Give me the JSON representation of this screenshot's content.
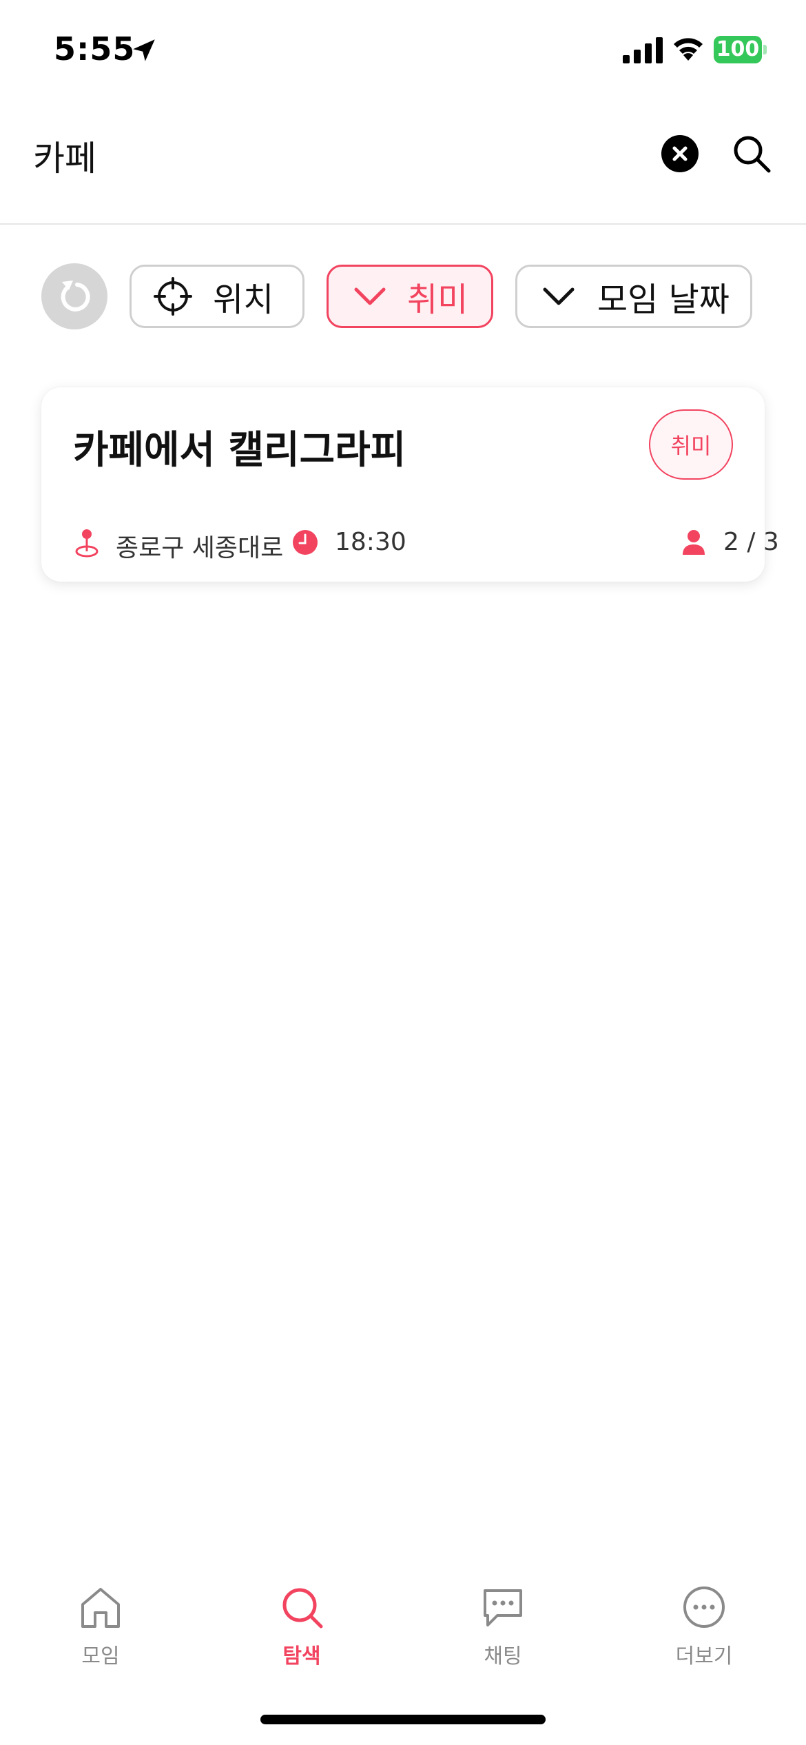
{
  "status_bar": {
    "time": "5:55",
    "battery_level": "100",
    "icons": [
      "location-arrow-icon",
      "cellular-signal-icon",
      "wifi-icon",
      "battery-icon"
    ]
  },
  "search": {
    "query": "카페",
    "clear_icon": "clear-icon",
    "search_icon": "search-icon"
  },
  "filters": {
    "reset_icon": "reset-icon",
    "chips": [
      {
        "label": "위치",
        "icon": "crosshair-icon",
        "active": false
      },
      {
        "label": "취미",
        "icon": "chevron-down-icon",
        "active": true
      },
      {
        "label": "모임 날짜",
        "icon": "chevron-down-icon",
        "active": false
      }
    ]
  },
  "results": [
    {
      "title": "카페에서 캘리그라피",
      "tag": "취미",
      "address": "종로구 세종대로",
      "time": "18:30",
      "participants": "2 / 3"
    }
  ],
  "tab_bar": {
    "tabs": [
      {
        "label": "모임",
        "icon": "home-icon",
        "active": false
      },
      {
        "label": "탐색",
        "icon": "search-icon",
        "active": true
      },
      {
        "label": "채팅",
        "icon": "chat-bubble-icon",
        "active": false
      },
      {
        "label": "더보기",
        "icon": "more-icon",
        "active": false
      }
    ]
  },
  "colors": {
    "accent": "#f2435f",
    "accent_bg": "#fff1f3",
    "battery": "#34c759",
    "inactive_tab": "#8a8a8a"
  }
}
